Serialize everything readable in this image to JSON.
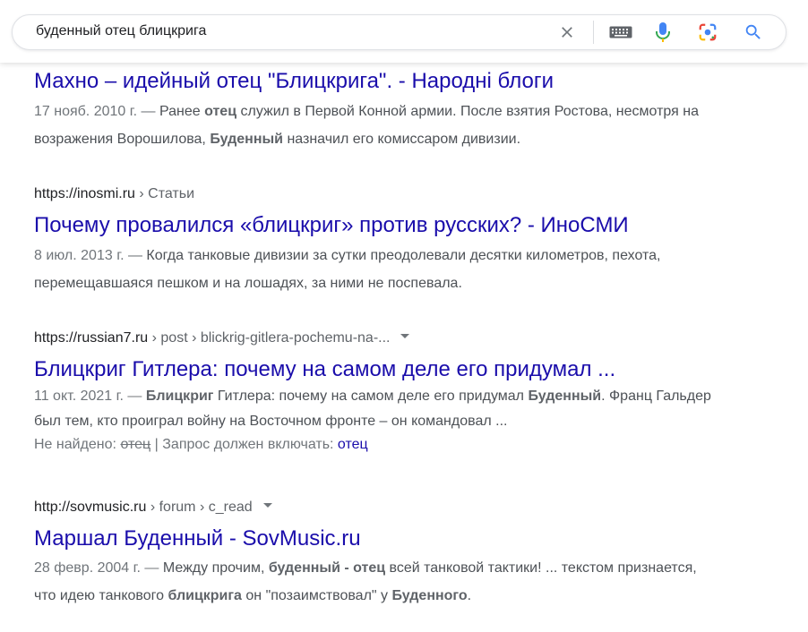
{
  "search": {
    "query": "буденный отец блицкрига"
  },
  "icons": {
    "clear": "close-icon",
    "keyboard": "keyboard-icon",
    "voice": "microphone-icon",
    "lens": "camera-lens-icon",
    "search": "search-icon"
  },
  "colors": {
    "link": "#1a0dab",
    "text": "#4d5156",
    "mic_blue": "#4285f4",
    "mic_red": "#ea4335",
    "lens_yellow": "#fbbc05",
    "lens_green": "#34a853"
  },
  "results": [
    {
      "title": "Махно – идейный отец \"Блицкрига\". - Народні блоги",
      "date": "17 нояб. 2010 г. — ",
      "snippet_parts": [
        {
          "t": "Ранее ",
          "b": false
        },
        {
          "t": "отец",
          "b": true
        },
        {
          "t": " служил в Первой Конной армии. После взятия Ростова, несмотря на возражения Ворошилова, ",
          "b": false
        },
        {
          "t": "Буденный",
          "b": true
        },
        {
          "t": " назначил его комиссаром дивизии.",
          "b": false
        }
      ]
    },
    {
      "url": "https://inosmi.ru",
      "breadcrumb": " › Статьи",
      "title": "Почему провалился «блицкриг» против русских? - ИноСМИ",
      "date": "8 июл. 2013 г. — ",
      "snippet_parts": [
        {
          "t": "Когда танковые дивизии за сутки преодолевали десятки километров, пехота, перемещавшаяся пешком и на лошадях, за ними не поспевала.",
          "b": false
        }
      ]
    },
    {
      "url": "https://russian7.ru",
      "breadcrumb": " › post › blickrig-gitlera-pochemu-na-...",
      "title": "Блицкриг Гитлера: почему на самом деле его придумал ...",
      "date": "11 окт. 2021 г. — ",
      "snippet_parts": [
        {
          "t": "Блицкриг",
          "b": true
        },
        {
          "t": " Гитлера: почему на самом деле его придумал ",
          "b": false
        },
        {
          "t": "Буденный",
          "b": true
        },
        {
          "t": ". Франц Гальдер был тем, кто проиграл войну на Восточном фронте – он командовал ...",
          "b": false
        }
      ],
      "missing_label": "Не найдено: ",
      "missing_word": "отец",
      "must_include_label": " | Запрос должен включать: ",
      "must_include_word": "отец"
    },
    {
      "url": "http://sovmusic.ru",
      "breadcrumb": " › forum › c_read",
      "title": "Маршал Буденный - SovMusic.ru",
      "date": "28 февр. 2004 г. — ",
      "snippet_parts": [
        {
          "t": "Между прочим, ",
          "b": false
        },
        {
          "t": "буденный - отец",
          "b": true
        },
        {
          "t": " всей танковой тактики! ... текстом признается, что идею танкового ",
          "b": false
        },
        {
          "t": "блицкрига",
          "b": true
        },
        {
          "t": " он \"позаимствовал\" у ",
          "b": false
        },
        {
          "t": "Буденного",
          "b": true
        },
        {
          "t": ".",
          "b": false
        }
      ]
    }
  ]
}
